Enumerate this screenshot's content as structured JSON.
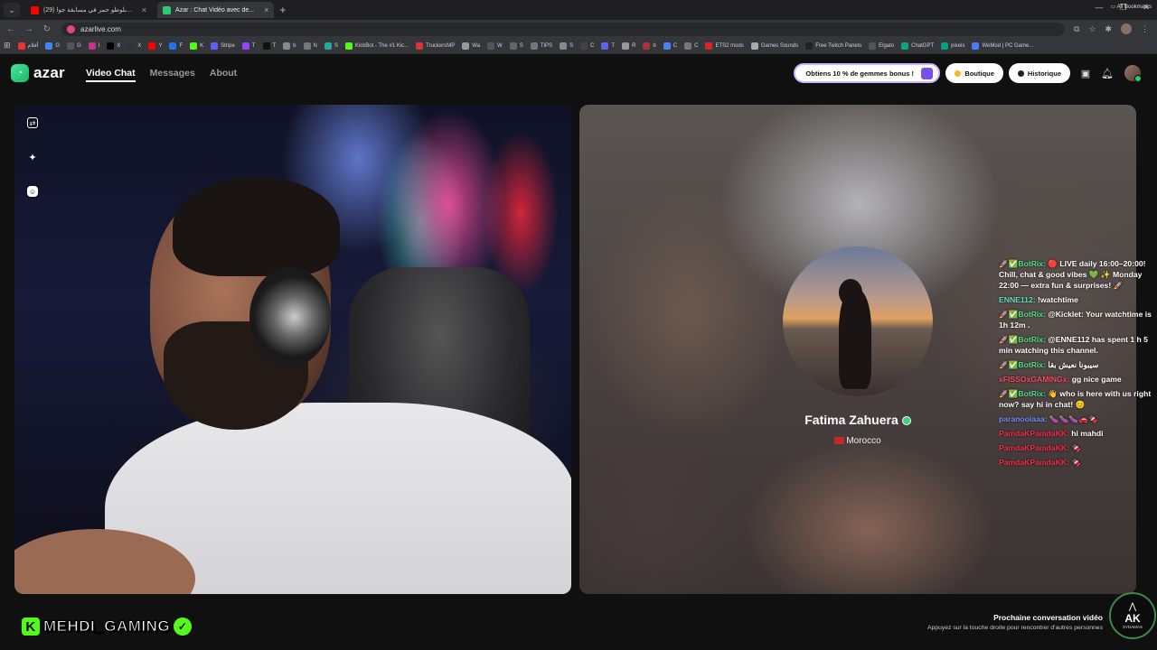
{
  "browser": {
    "tabs": [
      {
        "title": "(29) بلوطو حمر في مسابقة جوا...",
        "favicon_color": "#ff0000",
        "active": false
      },
      {
        "title": "Azar : Chat Vidéo avec de...",
        "favicon_color": "#2ecc71",
        "active": true
      }
    ],
    "url": "azarlive.com",
    "bookmarks": [
      {
        "label": "أفلام",
        "color": "#e33"
      },
      {
        "label": "G",
        "color": "#4285f4"
      },
      {
        "label": "G",
        "color": "#555"
      },
      {
        "label": "I",
        "color": "#c13584"
      },
      {
        "label": "X",
        "color": "#000"
      },
      {
        "label": "X",
        "color": "#333"
      },
      {
        "label": "Y",
        "color": "#f00"
      },
      {
        "label": "F",
        "color": "#1877f2"
      },
      {
        "label": "K",
        "color": "#53fc18"
      },
      {
        "label": "Stripe",
        "color": "#635bff"
      },
      {
        "label": "T",
        "color": "#9146ff"
      },
      {
        "label": "T",
        "color": "#111"
      },
      {
        "label": "b",
        "color": "#888"
      },
      {
        "label": "N",
        "color": "#777"
      },
      {
        "label": "S",
        "color": "#2a9"
      },
      {
        "label": "KickBot - The #1 Kic...",
        "color": "#53fc18"
      },
      {
        "label": "TruckersMP",
        "color": "#d33"
      },
      {
        "label": "Wa",
        "color": "#999"
      },
      {
        "label": "W",
        "color": "#555"
      },
      {
        "label": "S",
        "color": "#666"
      },
      {
        "label": "TIPS",
        "color": "#777"
      },
      {
        "label": "S",
        "color": "#888"
      },
      {
        "label": "C",
        "color": "#444"
      },
      {
        "label": "T",
        "color": "#5865f2"
      },
      {
        "label": "R",
        "color": "#999"
      },
      {
        "label": "b",
        "color": "#a33"
      },
      {
        "label": "C",
        "color": "#4285f4"
      },
      {
        "label": "C",
        "color": "#777"
      },
      {
        "label": "ETS2 mods",
        "color": "#d22"
      },
      {
        "label": "Games Sounds",
        "color": "#aaa"
      },
      {
        "label": "Free Twitch Panels",
        "color": "#222"
      },
      {
        "label": "Elgato",
        "color": "#555"
      },
      {
        "label": "ChatGPT",
        "color": "#10a37f"
      },
      {
        "label": "pixels",
        "color": "#05a081"
      },
      {
        "label": "WeMod | PC Game...",
        "color": "#4a7cff"
      }
    ],
    "all_bookmarks": "All Bookmarks"
  },
  "header": {
    "logo": "azar",
    "nav": [
      "Video Chat",
      "Messages",
      "About"
    ],
    "promo": "Obtiens 10 % de gemmes bonus !",
    "boutique": "Boutique",
    "historique": "Historique"
  },
  "profile": {
    "name": "Fatima Zahuera",
    "country": "Morocco"
  },
  "chat": [
    {
      "user": "🚀✅BotRix:",
      "text": "🔴 LIVE daily 16:00–20:00! Chill, chat & good vibes 💚 ✨ Monday 22:00 — extra fun & surprises! 🚀",
      "cls": "u-bot"
    },
    {
      "user": "ENNE112:",
      "text": "!watchtime",
      "cls": "u-enne"
    },
    {
      "user": "🚀✅BotRix:",
      "text": "@Kicklet: Your watchtime is 1h 12m .",
      "cls": "u-bot"
    },
    {
      "user": "🚀✅BotRix:",
      "text": "@ENNE112 has spent 1 h 5 min watching this channel.",
      "cls": "u-bot"
    },
    {
      "user": "🚀✅BotRix:",
      "text": "سيبونا نعيش بقا",
      "cls": "u-bot"
    },
    {
      "user": "xFISSOxGAMINGx:",
      "text": "gg nice game",
      "cls": "u-fisso"
    },
    {
      "user": "🚀✅BotRix:",
      "text": "👋 who is here with us right now? say hi in chat! 😊",
      "cls": "u-bot"
    },
    {
      "user": "paranooiaaa:",
      "text": "🍆🍆🍆🚗🍫",
      "cls": "u-para"
    },
    {
      "user": "PamdaKPamdaKK:",
      "text": "hi mahdi",
      "cls": "u-pamdal"
    },
    {
      "user": "PamdaKPamdaKK:",
      "text": "🍫",
      "cls": "u-pamdal"
    },
    {
      "user": "PamdaKPamdaKK:",
      "text": "🍫",
      "cls": "u-pamdal"
    }
  ],
  "streamer": {
    "name": "MEHDI_GAMING"
  },
  "next": {
    "title": "Prochaine conversation vidéo",
    "subtitle": "Appuyez sur la touche droite pour rencontrer d'autres personnes"
  },
  "ak_logo": {
    "text": "AK",
    "sub": "SYDAMAS"
  },
  "colors": {
    "accent": "#2ecc71",
    "kick_green": "#53fc18",
    "background": "#101010"
  }
}
